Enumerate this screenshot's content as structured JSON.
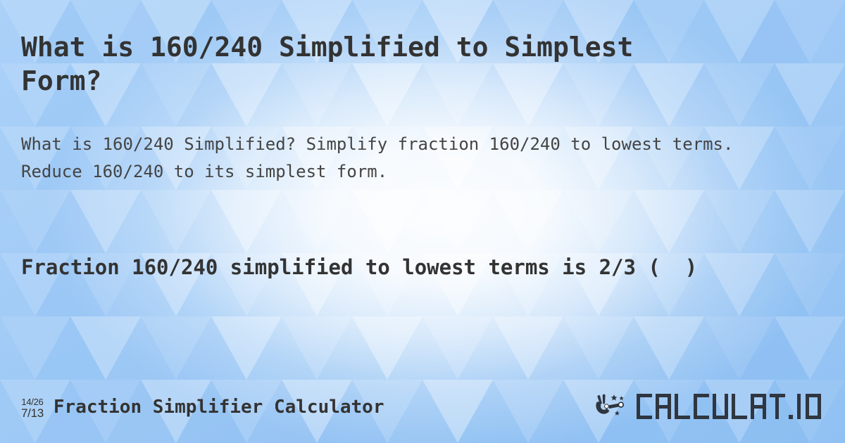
{
  "page": {
    "title": "What is 160/240 Simplified to Simplest Form?",
    "description": "What is 160/240 Simplified? Simplify fraction 160/240 to lowest terms. Reduce 160/240 to its simplest form.",
    "answer": "Fraction 160/240 simplified to lowest terms is 2/3 (  )"
  },
  "fraction": {
    "numerator": "160",
    "denominator": "240",
    "original": "160/240",
    "simplified": "2/3"
  },
  "footer": {
    "icon": {
      "name": "fraction-simplify-icon",
      "top": "14/26",
      "bottom": "7/13"
    },
    "title": "Fraction Simplifier Calculator"
  },
  "logo": {
    "mark_name": "hand-magic-wand-icon",
    "text": "CALCULAT.IO"
  },
  "colors": {
    "ink": "#333333",
    "ink_muted": "#444444",
    "bg_edge": "#8fc4f5",
    "bg_left": "#c5dffa",
    "bg_center": "#ffffff",
    "logo_ink": "#2f3640"
  }
}
